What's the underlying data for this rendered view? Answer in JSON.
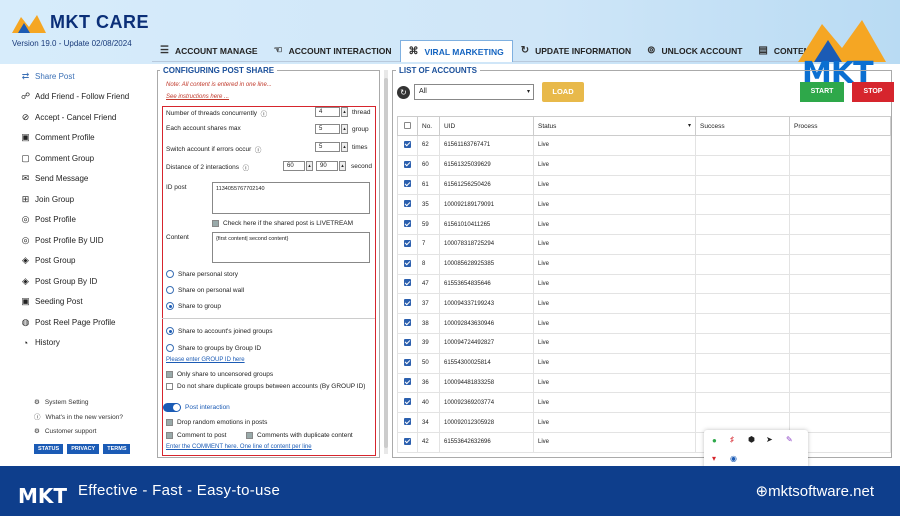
{
  "header": {
    "brand": "MKT CARE",
    "version": "Version  19.0  - Update  02/08/2024",
    "logo_text": "MKT"
  },
  "tabs": [
    {
      "label": "ACCOUNT MANAGE",
      "icon": "list-icon"
    },
    {
      "label": "ACCOUNT INTERACTION",
      "icon": "hand-icon"
    },
    {
      "label": "VIRAL MARKETING",
      "icon": "share-icon",
      "active": true
    },
    {
      "label": "UPDATE INFORMATION",
      "icon": "refresh-icon"
    },
    {
      "label": "UNLOCK ACCOUNT",
      "icon": "unlock-icon"
    },
    {
      "label": "CONTENT MANAGE",
      "icon": "content-icon"
    }
  ],
  "sidebar": {
    "items": [
      {
        "label": "Share Post",
        "icon": "share-icon",
        "active": true
      },
      {
        "label": "Add Friend - Follow Friend",
        "icon": "add-friend-icon"
      },
      {
        "label": "Accept - Cancel Friend",
        "icon": "check-circle-icon"
      },
      {
        "label": "Comment Profile",
        "icon": "comment-icon"
      },
      {
        "label": "Comment Group",
        "icon": "comment-group-icon"
      },
      {
        "label": "Send Message",
        "icon": "message-icon"
      },
      {
        "label": "Join Group",
        "icon": "join-group-icon"
      },
      {
        "label": "Post Profile",
        "icon": "post-icon"
      },
      {
        "label": "Post Profile By UID",
        "icon": "post-uid-icon"
      },
      {
        "label": "Post Group",
        "icon": "post-group-icon"
      },
      {
        "label": "Post Group By ID",
        "icon": "post-group-id-icon"
      },
      {
        "label": "Seeding Post",
        "icon": "seeding-icon"
      },
      {
        "label": "Post Reel Page Profile",
        "icon": "reel-icon"
      },
      {
        "label": "History",
        "icon": "history-icon"
      }
    ],
    "footer": [
      {
        "label": "System Setting",
        "icon": "gear-icon"
      },
      {
        "label": "What's in the new version?",
        "icon": "info-icon"
      },
      {
        "label": "Customer support",
        "icon": "support-icon"
      }
    ],
    "badges": [
      "STATUS",
      "PRIVACY",
      "TERMS"
    ]
  },
  "config": {
    "title": "CONFIGURING POST SHARE",
    "note1": "Note: All content is entered in one line...",
    "note2": "See instructions here ...",
    "threads_label": "Number of threads concurrently",
    "threads_value": "4",
    "threads_unit": "thread",
    "shares_label": "Each account shares max",
    "shares_value": "5",
    "shares_unit": "group",
    "switch_label": "Switch account if errors occur",
    "switch_value": "5",
    "switch_unit": "times",
    "distance_label": "Distance of 2 interactions",
    "distance_min": "60",
    "distance_max": "90",
    "distance_unit": "second",
    "id_post_label": "ID post",
    "id_post_value": "1134055767702140",
    "livestream_label": "Check here if the shared post is LIVETREAM",
    "content_label": "Content",
    "content_value": "{first content| second content}",
    "share_personal_story": "Share personal story",
    "share_personal_wall": "Share on personal wall",
    "share_to_group": "Share to group",
    "share_joined": "Share to account's joined groups",
    "share_by_id": "Share to groups by Group ID",
    "enter_group_id": "Please enter GROUP ID here",
    "only_uncensored": "Only share to uncensored groups",
    "no_duplicate": "Do not share duplicate groups between accounts (By GROUP ID)",
    "post_interaction": "Post interaction",
    "drop_emotions": "Drop random emotions in posts",
    "comment_to_post": "Comment to post",
    "comments_duplicate": "Comments with duplicate content",
    "enter_comment": "Enter the COMMENT here.  One line of content per line"
  },
  "list": {
    "title": "LIST OF ACCOUNTS",
    "filter": "All",
    "load": "LOAD",
    "start": "START",
    "stop": "STOP",
    "columns": [
      "No.",
      "UID",
      "Status",
      "Success",
      "Process"
    ],
    "rows": [
      [
        "62",
        "61561163767471",
        "Live"
      ],
      [
        "60",
        "61561325039629",
        "Live"
      ],
      [
        "61",
        "61561256250426",
        "Live"
      ],
      [
        "35",
        "100092189179091",
        "Live"
      ],
      [
        "59",
        "61561010411265",
        "Live"
      ],
      [
        "7",
        "100078318725294",
        "Live"
      ],
      [
        "8",
        "100085628925385",
        "Live"
      ],
      [
        "47",
        "61553654835646",
        "Live"
      ],
      [
        "37",
        "100094337199243",
        "Live"
      ],
      [
        "38",
        "100092843630946",
        "Live"
      ],
      [
        "39",
        "100094724492827",
        "Live"
      ],
      [
        "50",
        "61554300025814",
        "Live"
      ],
      [
        "36",
        "100094481833258",
        "Live"
      ],
      [
        "40",
        "100092369203774",
        "Live"
      ],
      [
        "34",
        "100092012305928",
        "Live"
      ],
      [
        "42",
        "61553642632696",
        "Live"
      ]
    ]
  },
  "bottom": {
    "slogan": "Effective - Fast - Easy-to-use",
    "site": "mktsoftware.net",
    "logo": "MKT"
  },
  "colors": {
    "primary": "#1b5bb5",
    "start": "#2ea84a",
    "stop": "#d6252d",
    "load": "#e8b94a",
    "highlight": "#d6252d"
  }
}
